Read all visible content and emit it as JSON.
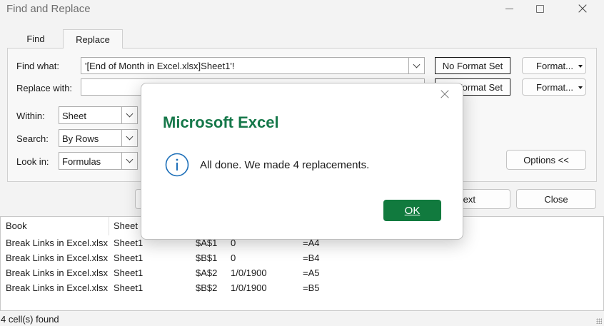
{
  "window": {
    "title": "Find and Replace",
    "minimize_icon": "minimize-icon",
    "maximize_icon": "maximize-icon",
    "close_icon": "close-icon"
  },
  "tabs": [
    {
      "label": "Find",
      "active": false
    },
    {
      "label": "Replace",
      "active": true
    }
  ],
  "form": {
    "find_what_label": "Find what:",
    "find_what_value": "'[End of Month in Excel.xlsx]Sheet1'!",
    "replace_with_label": "Replace with:",
    "replace_with_value": "",
    "no_format_set_label": "No Format Set",
    "replace_format_label": "Format Set",
    "format_button_label": "Format...",
    "within_label": "Within:",
    "within_value": "Sheet",
    "search_label": "Search:",
    "search_value": "By Rows",
    "look_in_label": "Look in:",
    "look_in_value": "Formulas",
    "options_button_label": "Options <<"
  },
  "buttons": {
    "find_next_label": "ext",
    "close_label": "Close"
  },
  "results": {
    "columns": [
      "Book",
      "Sheet"
    ],
    "rows": [
      {
        "book": "Break Links in Excel.xlsx",
        "sheet": "Sheet1",
        "cell": "$A$1",
        "value": "0",
        "formula": "=A4"
      },
      {
        "book": "Break Links in Excel.xlsx",
        "sheet": "Sheet1",
        "cell": "$B$1",
        "value": "0",
        "formula": "=B4"
      },
      {
        "book": "Break Links in Excel.xlsx",
        "sheet": "Sheet1",
        "cell": "$A$2",
        "value": "1/0/1900",
        "formula": "=A5"
      },
      {
        "book": "Break Links in Excel.xlsx",
        "sheet": "Sheet1",
        "cell": "$B$2",
        "value": "1/0/1900",
        "formula": "=B5"
      }
    ]
  },
  "status": {
    "text": "4 cell(s) found"
  },
  "modal": {
    "title": "Microsoft Excel",
    "message": "All done. We made 4 replacements.",
    "ok_label": "OK",
    "info_icon": "info-icon",
    "close_icon": "close-icon",
    "title_color": "#16784a",
    "ok_color": "#117a3e"
  }
}
